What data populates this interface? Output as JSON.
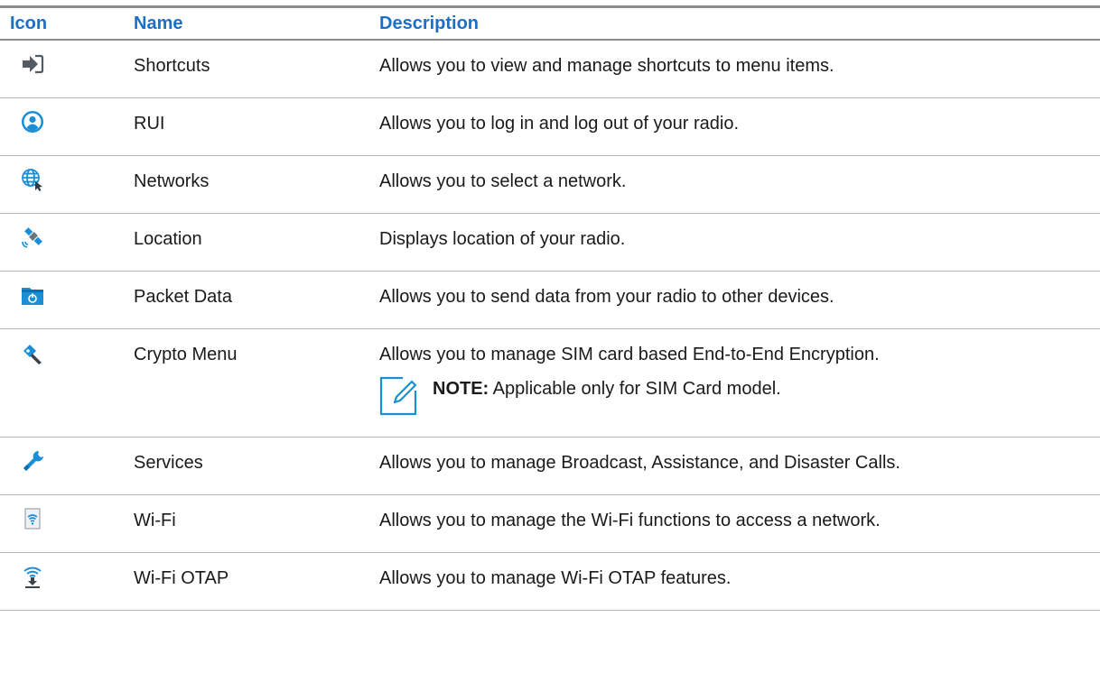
{
  "header": {
    "icon": "Icon",
    "name": "Name",
    "description": "Description"
  },
  "colors": {
    "header_text": "#1c6fc8",
    "icon_blue": "#1a8fd6",
    "rule": "#8c8c8c"
  },
  "rows": [
    {
      "icon": "shortcut-arrow-icon",
      "name": "Shortcuts",
      "description": "Allows you to view and manage shortcuts to menu items."
    },
    {
      "icon": "user-circle-icon",
      "name": "RUI",
      "description": "Allows you to log in and log out of your radio."
    },
    {
      "icon": "network-globe-icon",
      "name": "Networks",
      "description": "Allows you to select a network."
    },
    {
      "icon": "satellite-icon",
      "name": "Location",
      "description": "Displays location of your radio."
    },
    {
      "icon": "packet-data-folder-icon",
      "name": "Packet Data",
      "description": "Allows you to send data from your radio to other devices."
    },
    {
      "icon": "crypto-key-icon",
      "name": "Crypto Menu",
      "description": "Allows you to manage SIM card based End-to-End Encryption.",
      "note_label": "NOTE:",
      "note_text": " Applicable only for SIM Card model."
    },
    {
      "icon": "wrench-icon",
      "name": "Services",
      "description": "Allows you to manage Broadcast, Assistance, and Disaster Calls."
    },
    {
      "icon": "wifi-document-icon",
      "name": "Wi-Fi",
      "description": "Allows you to manage the Wi-Fi functions to access a network."
    },
    {
      "icon": "wifi-download-icon",
      "name": "Wi-Fi OTAP",
      "description": "Allows you to manage Wi-Fi OTAP features."
    }
  ]
}
